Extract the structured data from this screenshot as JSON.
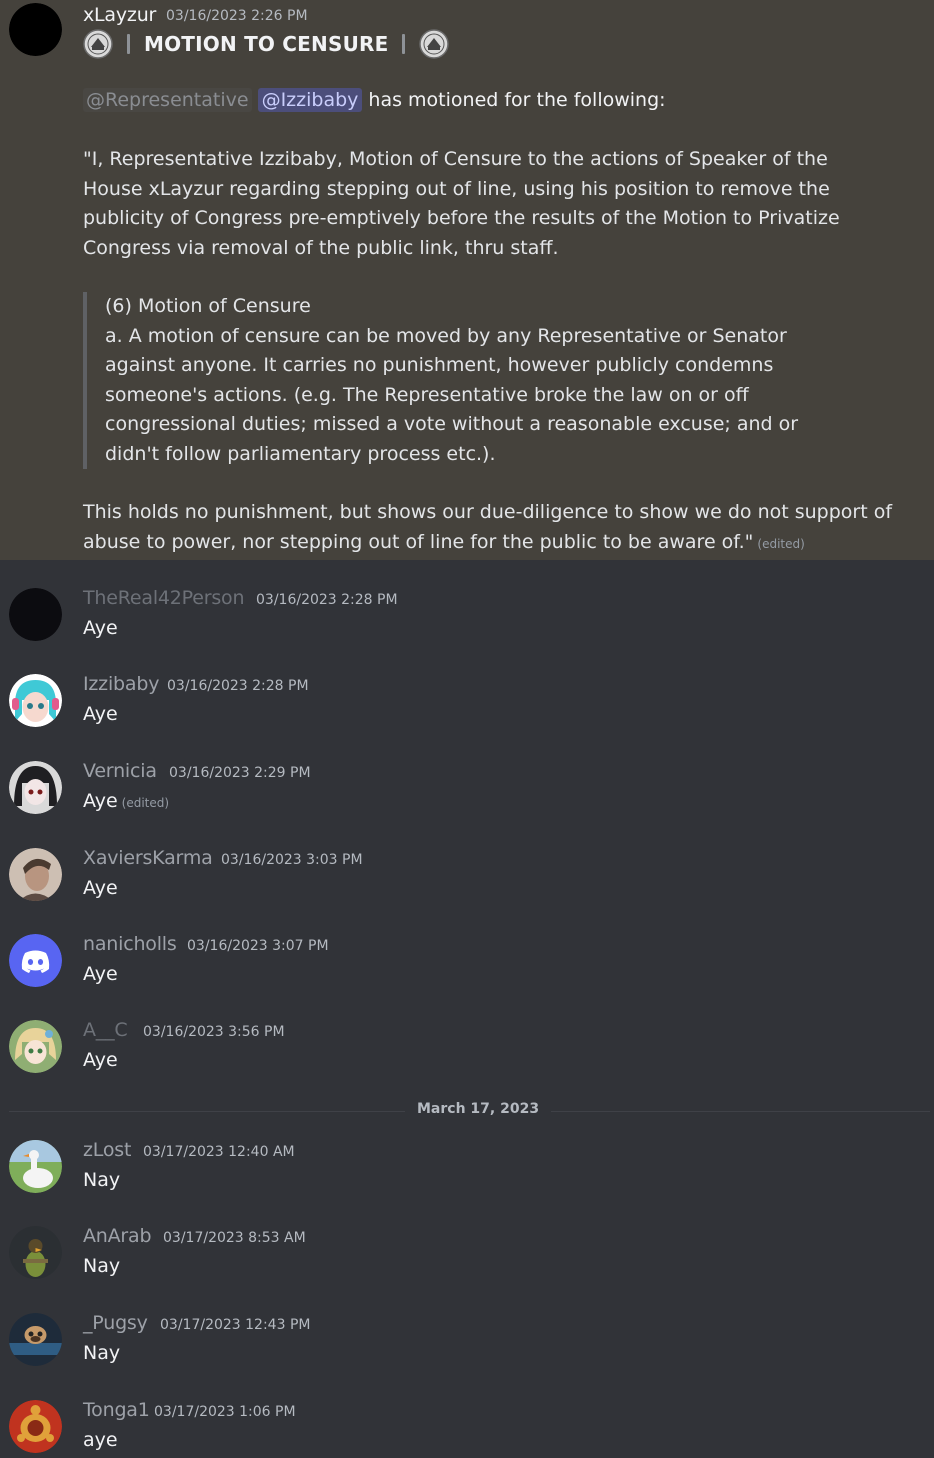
{
  "main_message": {
    "author": "xLayzur",
    "timestamp": "03/16/2023 2:26 PM",
    "title": "MOTION TO CENSURE",
    "role_mention": "@Representative",
    "user_mention": "@Izzibaby",
    "intro_suffix": "has motioned for the following:",
    "paragraph": "\"I, Representative Izzibaby, Motion of Censure to the actions of Speaker of the House xLayzur regarding stepping out of line, using his position to remove the publicity of Congress pre-emptively before the results of the Motion to Privatize Congress via removal of the public link, thru staff.",
    "quote_title": "(6) Motion of Censure",
    "quote_body": "a. A motion of censure can be moved by any Representative or Senator against anyone. It carries no punishment, however publicly condemns someone's actions. (e.g. The Representative broke the law on or off congressional duties; missed a vote without a reasonable excuse; and or didn't follow parliamentary process etc.).",
    "closing": "This holds no punishment, but shows our due-diligence to show we do not support of abuse to power, nor stepping out of line for the public to be aware of.\"",
    "edited_label": "(edited)"
  },
  "replies": [
    {
      "author": "TheReal42Person",
      "timestamp": "03/16/2023 2:28 PM",
      "text": "Aye",
      "edited": "",
      "name_color": "#6d7178",
      "avatar_icon": "dark-avatar-icon"
    },
    {
      "author": "Izzibaby",
      "timestamp": "03/16/2023 2:28 PM",
      "text": "Aye",
      "edited": "",
      "name_color": "#9da1a8",
      "avatar_icon": "anime-girl-avatar-icon"
    },
    {
      "author": "Vernicia",
      "timestamp": "03/16/2023 2:29 PM",
      "text": "Aye",
      "edited": "(edited)",
      "name_color": "#9da1a8",
      "avatar_icon": "anime-dark-avatar-icon"
    },
    {
      "author": "XaviersKarma",
      "timestamp": "03/16/2023 3:03 PM",
      "text": "Aye",
      "edited": "",
      "name_color": "#9da1a8",
      "avatar_icon": "photo-avatar-icon"
    },
    {
      "author": "nanicholls",
      "timestamp": "03/16/2023 3:07 PM",
      "text": "Aye",
      "edited": "",
      "name_color": "#9da1a8",
      "avatar_icon": "discord-logo-icon"
    },
    {
      "author": "A__C",
      "timestamp": "03/16/2023 3:56 PM",
      "text": "Aye",
      "edited": "",
      "name_color": "#6d7178",
      "avatar_icon": "anime-blonde-avatar-icon"
    },
    {
      "author": "zLost",
      "timestamp": "03/17/2023 12:40 AM",
      "text": "Nay",
      "edited": "",
      "name_color": "#9da1a8",
      "avatar_icon": "goose-avatar-icon"
    },
    {
      "author": "AnArab",
      "timestamp": "03/17/2023 8:53 AM",
      "text": "Nay",
      "edited": "",
      "name_color": "#9da1a8",
      "avatar_icon": "duck-avatar-icon"
    },
    {
      "author": "_Pugsy",
      "timestamp": "03/17/2023 12:43 PM",
      "text": "Nay",
      "edited": "",
      "name_color": "#9da1a8",
      "avatar_icon": "pug-avatar-icon"
    },
    {
      "author": "Tonga1",
      "timestamp": "03/17/2023 1:06 PM",
      "text": "aye",
      "edited": "",
      "name_color": "#9da1a8",
      "avatar_icon": "turtle-avatar-icon"
    }
  ],
  "date_divider": "March 17, 2023",
  "colors": {
    "pinned_background": "#45423c",
    "chat_background": "#313338",
    "mention_user": "#5865f2"
  }
}
